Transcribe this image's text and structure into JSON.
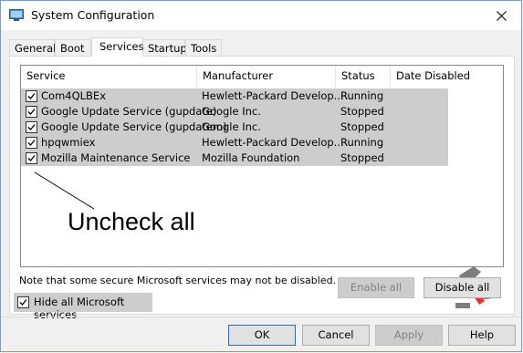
{
  "window": {
    "title": "System Configuration"
  },
  "tabs": [
    "General",
    "Boot",
    "Services",
    "Startup",
    "Tools"
  ],
  "active_tab": "Services",
  "columns": [
    "Service",
    "Manufacturer",
    "Status",
    "Date Disabled"
  ],
  "services": [
    {
      "name": "Com4QLBEx",
      "manufacturer": "Hewlett-Packard Develop...",
      "status": "Running",
      "date_disabled": "",
      "checked": true
    },
    {
      "name": "Google Update Service (gupdate)",
      "manufacturer": "Google Inc.",
      "status": "Stopped",
      "date_disabled": "",
      "checked": true
    },
    {
      "name": "Google Update Service (gupdatem)",
      "manufacturer": "Google Inc.",
      "status": "Stopped",
      "date_disabled": "",
      "checked": true
    },
    {
      "name": "hpqwmiex",
      "manufacturer": "Hewlett-Packard Develop...",
      "status": "Running",
      "date_disabled": "",
      "checked": true
    },
    {
      "name": "Mozilla Maintenance Service",
      "manufacturer": "Mozilla Foundation",
      "status": "Stopped",
      "date_disabled": "",
      "checked": true
    }
  ],
  "annotation": "Uncheck all",
  "note": "Note that some secure Microsoft services may not be disabled.",
  "buttons": {
    "enable_all": "Enable all",
    "disable_all": "Disable all",
    "ok": "OK",
    "cancel": "Cancel",
    "apply": "Apply",
    "help": "Help"
  },
  "hide_ms": {
    "label": "Hide all Microsoft services",
    "checked": true
  },
  "colors": {
    "selection": "#cdcdcd",
    "accent": "#0078d7",
    "logo_red": "#e8322b",
    "logo_gray": "#7d7d7d"
  }
}
